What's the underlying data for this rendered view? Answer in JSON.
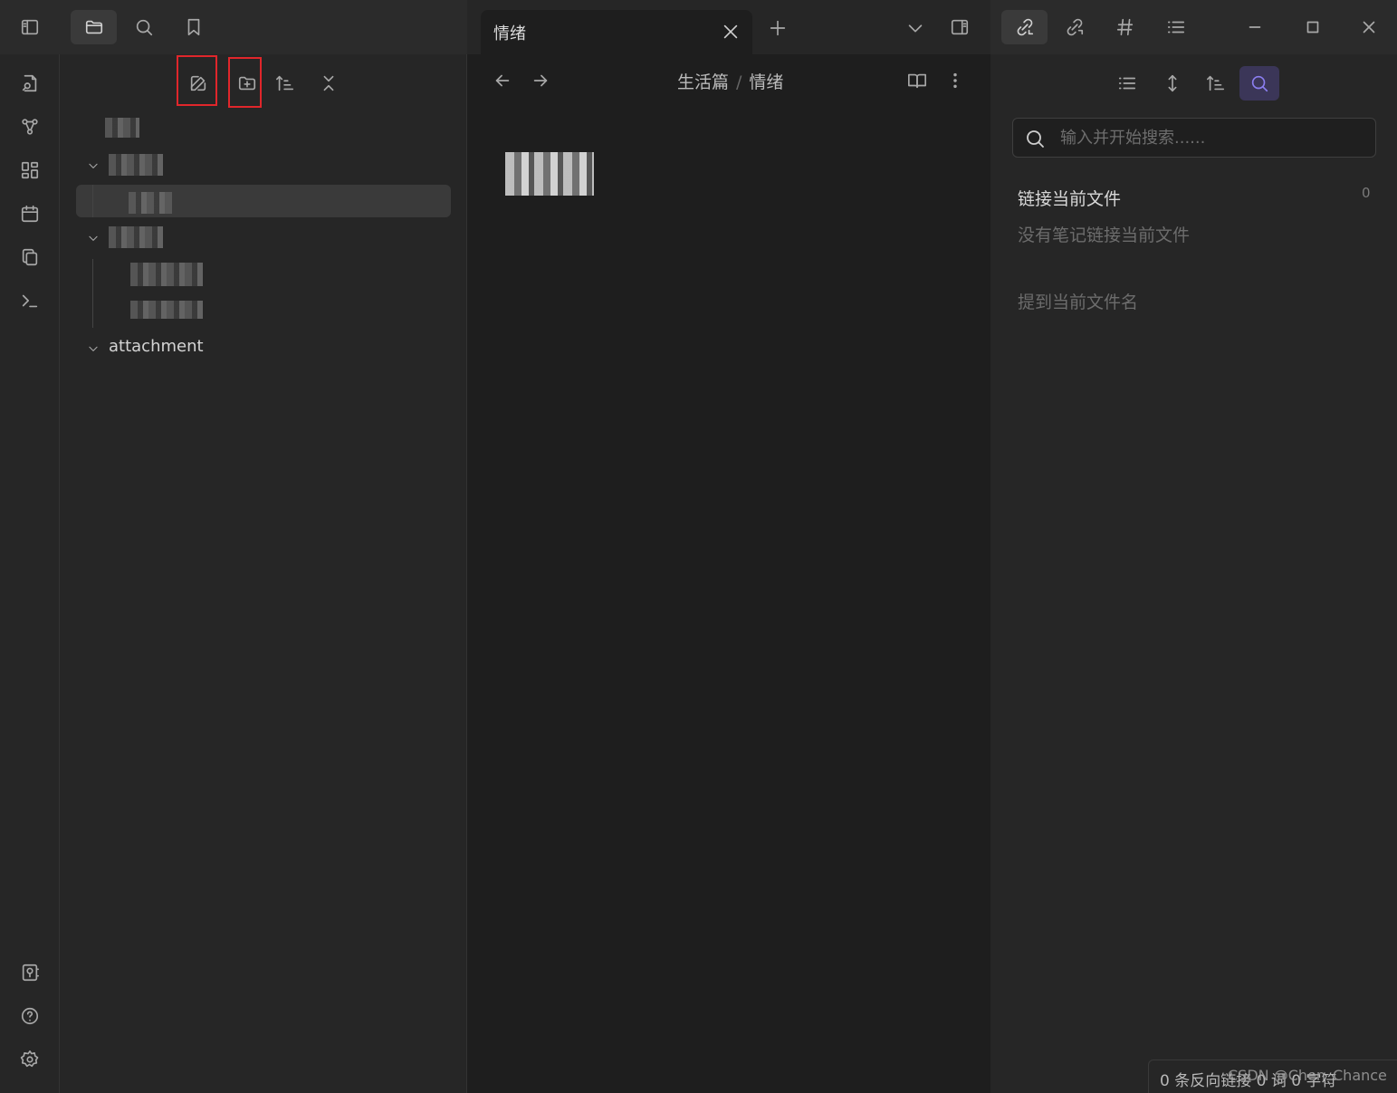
{
  "tab": {
    "title": "情绪"
  },
  "breadcrumb": {
    "parent": "生活篇",
    "separator": "/",
    "current": "情绪"
  },
  "file_tree": {
    "folder_attachment": "attachment"
  },
  "right_panel": {
    "search_placeholder": "输入并开始搜索......",
    "linked_title": "链接当前文件",
    "linked_count": "0",
    "linked_empty": "没有笔记链接当前文件",
    "unlinked_title": "提到当前文件名"
  },
  "status_bar": {
    "text": "0 条反向链接  0 词  0 字符"
  },
  "watermark": {
    "text": "CSDN @Chen_Chance"
  },
  "colors": {
    "accent": "#7f6df2",
    "highlight_box": "#e0262b",
    "background": "#1e1e1e",
    "panel": "#262626"
  }
}
